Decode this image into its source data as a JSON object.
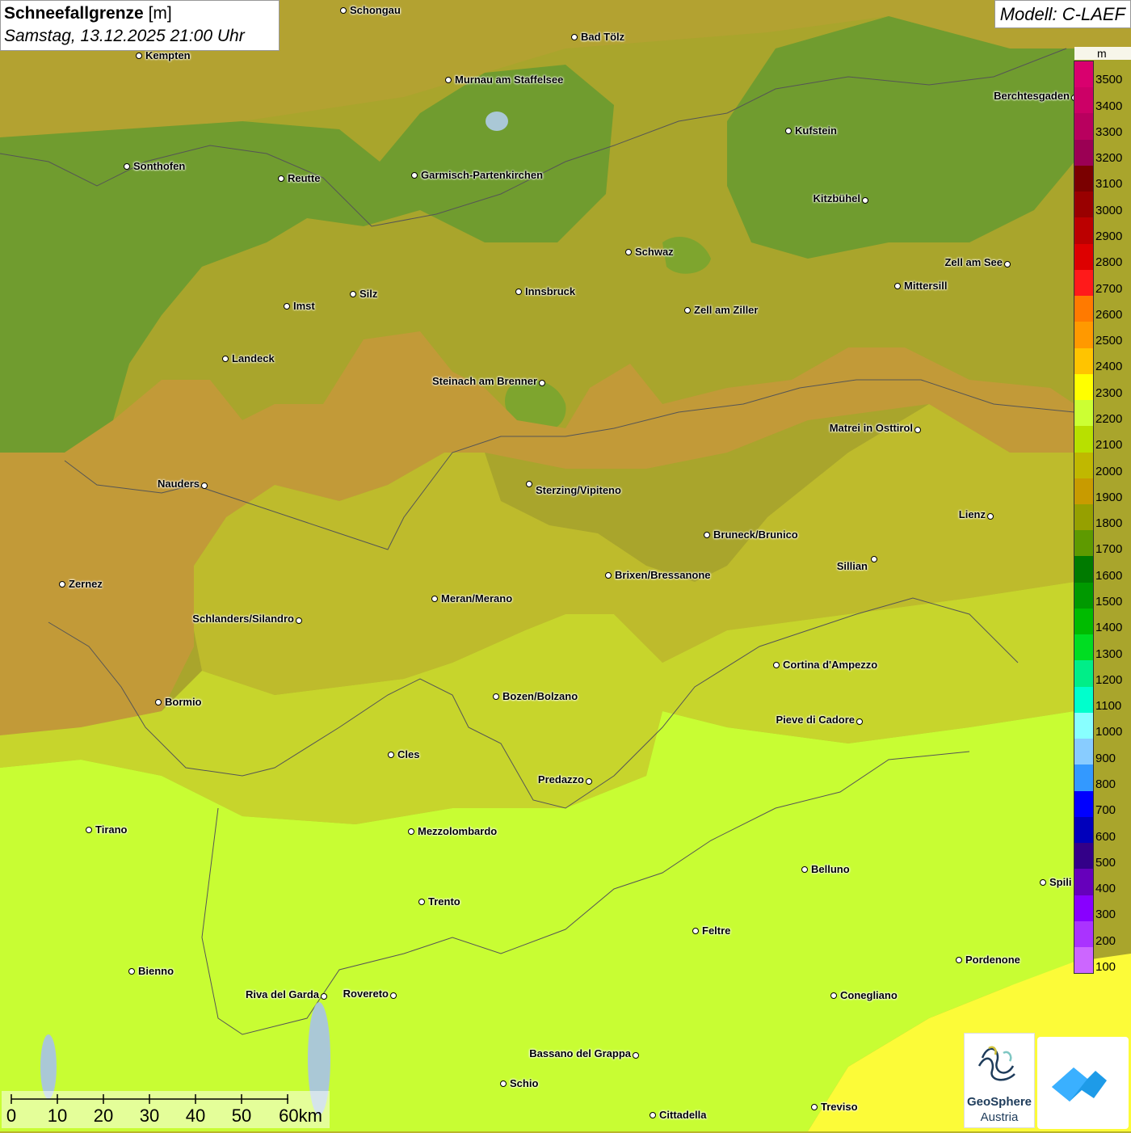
{
  "header": {
    "title_bold": "Schneefallgrenze",
    "title_unit": "[m]",
    "datetime": "Samstag, 13.12.2025 21:00 Uhr",
    "model": "Modell: C-LAEF"
  },
  "legend": {
    "unit": "m",
    "levels": [
      {
        "label": "3500",
        "color": "#d9006e"
      },
      {
        "label": "3400",
        "color": "#cc0066"
      },
      {
        "label": "3300",
        "color": "#b8005e"
      },
      {
        "label": "3200",
        "color": "#9b0054"
      },
      {
        "label": "3100",
        "color": "#7a0000"
      },
      {
        "label": "3000",
        "color": "#990000"
      },
      {
        "label": "2900",
        "color": "#bb0000"
      },
      {
        "label": "2800",
        "color": "#dd0000"
      },
      {
        "label": "2700",
        "color": "#ff1a1a"
      },
      {
        "label": "2600",
        "color": "#ff7a00"
      },
      {
        "label": "2500",
        "color": "#ff9900"
      },
      {
        "label": "2400",
        "color": "#ffc400"
      },
      {
        "label": "2300",
        "color": "#ffff00"
      },
      {
        "label": "2200",
        "color": "#ccff33"
      },
      {
        "label": "2100",
        "color": "#b8e000"
      },
      {
        "label": "2000",
        "color": "#c0b800"
      },
      {
        "label": "1900",
        "color": "#c89b00"
      },
      {
        "label": "1800",
        "color": "#96a000"
      },
      {
        "label": "1700",
        "color": "#5e9a00"
      },
      {
        "label": "1600",
        "color": "#007a00"
      },
      {
        "label": "1500",
        "color": "#009900"
      },
      {
        "label": "1400",
        "color": "#00bb00"
      },
      {
        "label": "1300",
        "color": "#00dd22"
      },
      {
        "label": "1200",
        "color": "#00ee88"
      },
      {
        "label": "1100",
        "color": "#00ffcc"
      },
      {
        "label": "1000",
        "color": "#88ffff"
      },
      {
        "label": "900",
        "color": "#88ccff"
      },
      {
        "label": "800",
        "color": "#3399ff"
      },
      {
        "label": "700",
        "color": "#0000ff"
      },
      {
        "label": "600",
        "color": "#0000bb"
      },
      {
        "label": "500",
        "color": "#330088"
      },
      {
        "label": "400",
        "color": "#6600bb"
      },
      {
        "label": "300",
        "color": "#8800ff"
      },
      {
        "label": "200",
        "color": "#aa33ff"
      },
      {
        "label": "100",
        "color": "#cc66ff"
      }
    ]
  },
  "cities": [
    {
      "name": "Schongau",
      "key": "schongau"
    },
    {
      "name": "Kempten",
      "key": "kempten"
    },
    {
      "name": "Bad Tölz",
      "key": "bad-toelz"
    },
    {
      "name": "Murnau am Staffelsee",
      "key": "murnau"
    },
    {
      "name": "Berchtesgaden",
      "key": "berchtesgaden"
    },
    {
      "name": "Kufstein",
      "key": "kufstein"
    },
    {
      "name": "Sonthofen",
      "key": "sonthofen"
    },
    {
      "name": "Reutte",
      "key": "reutte"
    },
    {
      "name": "Garmisch-Partenkirchen",
      "key": "garmisch"
    },
    {
      "name": "Kitzbühel",
      "key": "kitzbuehel"
    },
    {
      "name": "Schwaz",
      "key": "schwaz"
    },
    {
      "name": "Zell am See",
      "key": "zell-am-see"
    },
    {
      "name": "Innsbruck",
      "key": "innsbruck"
    },
    {
      "name": "Silz",
      "key": "silz"
    },
    {
      "name": "Imst",
      "key": "imst"
    },
    {
      "name": "Mittersill",
      "key": "mittersill"
    },
    {
      "name": "Zell am Ziller",
      "key": "zell-am-ziller"
    },
    {
      "name": "Landeck",
      "key": "landeck"
    },
    {
      "name": "Steinach am Brenner",
      "key": "steinach"
    },
    {
      "name": "Matrei in Osttirol",
      "key": "matrei"
    },
    {
      "name": "Nauders",
      "key": "nauders"
    },
    {
      "name": "Sterzing/Vipiteno",
      "key": "sterzing"
    },
    {
      "name": "Lienz",
      "key": "lienz"
    },
    {
      "name": "Bruneck/Brunico",
      "key": "bruneck"
    },
    {
      "name": "Sillian",
      "key": "sillian"
    },
    {
      "name": "Brixen/Bressanone",
      "key": "brixen"
    },
    {
      "name": "Zernez",
      "key": "zernez"
    },
    {
      "name": "Meran/Merano",
      "key": "meran"
    },
    {
      "name": "Schlanders/Silandro",
      "key": "schlanders"
    },
    {
      "name": "Cortina d'Ampezzo",
      "key": "cortina"
    },
    {
      "name": "Bozen/Bolzano",
      "key": "bozen"
    },
    {
      "name": "Bormio",
      "key": "bormio"
    },
    {
      "name": "Pieve di Cadore",
      "key": "pieve"
    },
    {
      "name": "Cles",
      "key": "cles"
    },
    {
      "name": "Predazzo",
      "key": "predazzo"
    },
    {
      "name": "Tirano",
      "key": "tirano"
    },
    {
      "name": "Mezzolombardo",
      "key": "mezzolombardo"
    },
    {
      "name": "Belluno",
      "key": "belluno"
    },
    {
      "name": "Spili",
      "key": "spilimbergo"
    },
    {
      "name": "Trento",
      "key": "trento"
    },
    {
      "name": "Feltre",
      "key": "feltre"
    },
    {
      "name": "Pordenone",
      "key": "pordenone"
    },
    {
      "name": "Bienno",
      "key": "bienno"
    },
    {
      "name": "Riva del Garda",
      "key": "riva"
    },
    {
      "name": "Rovereto",
      "key": "rovereto"
    },
    {
      "name": "Conegliano",
      "key": "conegliano"
    },
    {
      "name": "Bassano del Grappa",
      "key": "bassano"
    },
    {
      "name": "Schio",
      "key": "schio"
    },
    {
      "name": "Treviso",
      "key": "treviso"
    },
    {
      "name": "Cittadella",
      "key": "cittadella"
    }
  ],
  "scale": {
    "ticks": [
      "0",
      "10",
      "20",
      "30",
      "40",
      "50",
      "60km"
    ]
  },
  "logos": {
    "geosphere_line1": "GeoSphere",
    "geosphere_line2": "Austria"
  },
  "colors": {
    "zone_1700": "#6f9d2e",
    "zone_1800": "#9ea22c",
    "zone_1900": "#bf9a33",
    "zone_2000": "#bcbd2c",
    "zone_2100": "#bfd62a",
    "zone_2200": "#c9ff33",
    "zone_2300": "#fcfc33"
  }
}
